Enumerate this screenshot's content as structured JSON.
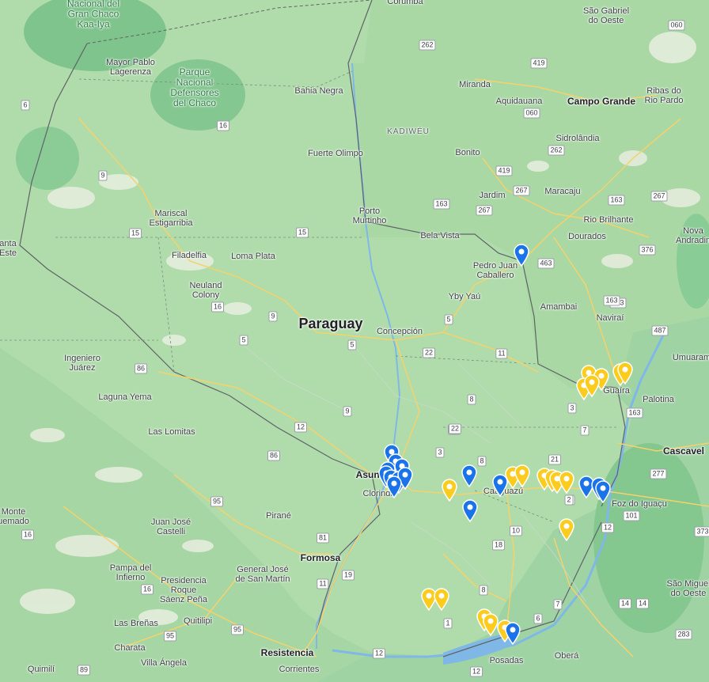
{
  "map": {
    "country_label": "Paraguay",
    "labels": [
      {
        "id": "gran-chaco",
        "text": "Nacional del\nGran Chaco\nKaa-Iya",
        "type": "park"
      },
      {
        "id": "mayor-pablo",
        "text": "Mayor Pablo\nLagerenza",
        "type": "town"
      },
      {
        "id": "parque-defensores",
        "text": "Parque\nNacional\nDefensores\ndel Chaco",
        "type": "park"
      },
      {
        "id": "bahia-negra",
        "text": "Bahia Negra",
        "type": "town"
      },
      {
        "id": "fuerte-olimpo",
        "text": "Fuerte Olimpo",
        "type": "town"
      },
      {
        "id": "mariscal",
        "text": "Mariscal\nEstigarribia",
        "type": "town"
      },
      {
        "id": "filadelfia",
        "text": "Filadelfia",
        "type": "town"
      },
      {
        "id": "loma-plata",
        "text": "Loma Plata",
        "type": "town"
      },
      {
        "id": "neuland",
        "text": "Neuland\nColony",
        "type": "town"
      },
      {
        "id": "porto-murtinho",
        "text": "Porto\nMurtinho",
        "type": "town"
      },
      {
        "id": "bela-vista",
        "text": "Bela Vista",
        "type": "town"
      },
      {
        "id": "pedro-juan",
        "text": "Pedro Juan\nCaballero",
        "type": "town"
      },
      {
        "id": "yby-yau",
        "text": "Yby Yaú",
        "type": "town"
      },
      {
        "id": "concepcion",
        "text": "Concepción",
        "type": "town"
      },
      {
        "id": "ingeniero-juarez",
        "text": "Ingeniero\nJuárez",
        "type": "town"
      },
      {
        "id": "laguna-yema",
        "text": "Laguna Yema",
        "type": "town"
      },
      {
        "id": "las-lomitas",
        "text": "Las Lomitas",
        "type": "town"
      },
      {
        "id": "juan-jose-castelli",
        "text": "Juan José\nCastelli",
        "type": "town"
      },
      {
        "id": "pampa-infierno",
        "text": "Pampa del\nInfierno",
        "type": "town"
      },
      {
        "id": "presidencia-roque",
        "text": "Presidencia\nRoque\nSáenz Peña",
        "type": "town"
      },
      {
        "id": "quitilipi",
        "text": "Quitilipi",
        "type": "town"
      },
      {
        "id": "las-brenas",
        "text": "Las Breñas",
        "type": "town"
      },
      {
        "id": "charata",
        "text": "Charata",
        "type": "town"
      },
      {
        "id": "villa-angela",
        "text": "Villa Ángela",
        "type": "town"
      },
      {
        "id": "quimili",
        "text": "Quimilí",
        "type": "town"
      },
      {
        "id": "monte-quemado",
        "text": "Monte\nuemado",
        "type": "town"
      },
      {
        "id": "santa-este",
        "text": "anta\nEste",
        "type": "town"
      },
      {
        "id": "pirane",
        "text": "Pirané",
        "type": "town"
      },
      {
        "id": "formosa",
        "text": "Formosa",
        "type": "city"
      },
      {
        "id": "general-jose",
        "text": "General José\nde San Martín",
        "type": "town"
      },
      {
        "id": "resistencia",
        "text": "Resistencia",
        "type": "city"
      },
      {
        "id": "corrientes",
        "text": "Corrientes",
        "type": "town"
      },
      {
        "id": "asuncion",
        "text": "Asunción",
        "type": "city"
      },
      {
        "id": "clorinda",
        "text": "Clorinda",
        "type": "town"
      },
      {
        "id": "caaguazu",
        "text": "Caaguazú",
        "type": "town"
      },
      {
        "id": "posadas",
        "text": "Posadas",
        "type": "town"
      },
      {
        "id": "obera",
        "text": "Oberá",
        "type": "town"
      },
      {
        "id": "foz",
        "text": "Foz do Iguaçu",
        "type": "town"
      },
      {
        "id": "cascavel",
        "text": "Cascavel",
        "type": "city"
      },
      {
        "id": "palotina",
        "text": "Palotina",
        "type": "town"
      },
      {
        "id": "umuarama",
        "text": "Umuaram",
        "type": "town"
      },
      {
        "id": "guaira",
        "text": "Guaíra",
        "type": "town"
      },
      {
        "id": "navirai",
        "text": "Naviraí",
        "type": "town"
      },
      {
        "id": "amambai",
        "text": "Amambai",
        "type": "town"
      },
      {
        "id": "dourados",
        "text": "Dourados",
        "type": "town"
      },
      {
        "id": "rio-brilhante",
        "text": "Rio Brilhante",
        "type": "town"
      },
      {
        "id": "nova-andradina",
        "text": "Nova\nAndradin",
        "type": "town"
      },
      {
        "id": "maracaju",
        "text": "Maracaju",
        "type": "town"
      },
      {
        "id": "jardim",
        "text": "Jardim",
        "type": "town"
      },
      {
        "id": "bonito",
        "text": "Bonito",
        "type": "town"
      },
      {
        "id": "sidrolandia",
        "text": "Sidrolândia",
        "type": "town"
      },
      {
        "id": "campo-grande",
        "text": "Campo Grande",
        "type": "city"
      },
      {
        "id": "ribas",
        "text": "Ribas do\nRio Pardo",
        "type": "town"
      },
      {
        "id": "aquidauana",
        "text": "Aquidauana",
        "type": "town"
      },
      {
        "id": "miranda",
        "text": "Miranda",
        "type": "town"
      },
      {
        "id": "sao-gabriel",
        "text": "São Gabriel\ndo Oeste",
        "type": "town"
      },
      {
        "id": "kadiweu",
        "text": "KADIWÉU",
        "type": "region"
      },
      {
        "id": "sao-miguel",
        "text": "São Miguel\ndo Oeste",
        "type": "town"
      },
      {
        "id": "corumba",
        "text": "Corumbá",
        "type": "town"
      }
    ],
    "routes": [
      "060",
      "262",
      "419",
      "262",
      "060",
      "419",
      "267",
      "267",
      "163",
      "267",
      "163",
      "463",
      "376",
      "163",
      "487",
      "163",
      "277",
      "101",
      "12",
      "373",
      "14",
      "283",
      "163",
      "5",
      "15",
      "9",
      "16",
      "6",
      "9",
      "15",
      "16",
      "5",
      "5",
      "22",
      "11",
      "8",
      "22",
      "3",
      "8",
      "21",
      "7",
      "3",
      "2",
      "10",
      "16",
      "18",
      "6",
      "8",
      "1",
      "7",
      "12",
      "12",
      "2",
      "86",
      "12",
      "86",
      "95",
      "81",
      "19",
      "11",
      "95",
      "16",
      "95",
      "16",
      "89",
      "9",
      "14",
      "22"
    ],
    "markers": {
      "blue_count": 16,
      "yellow_count": 27,
      "colors": {
        "blue": "#1a73e8",
        "yellow": "#fbcc1e"
      }
    }
  }
}
